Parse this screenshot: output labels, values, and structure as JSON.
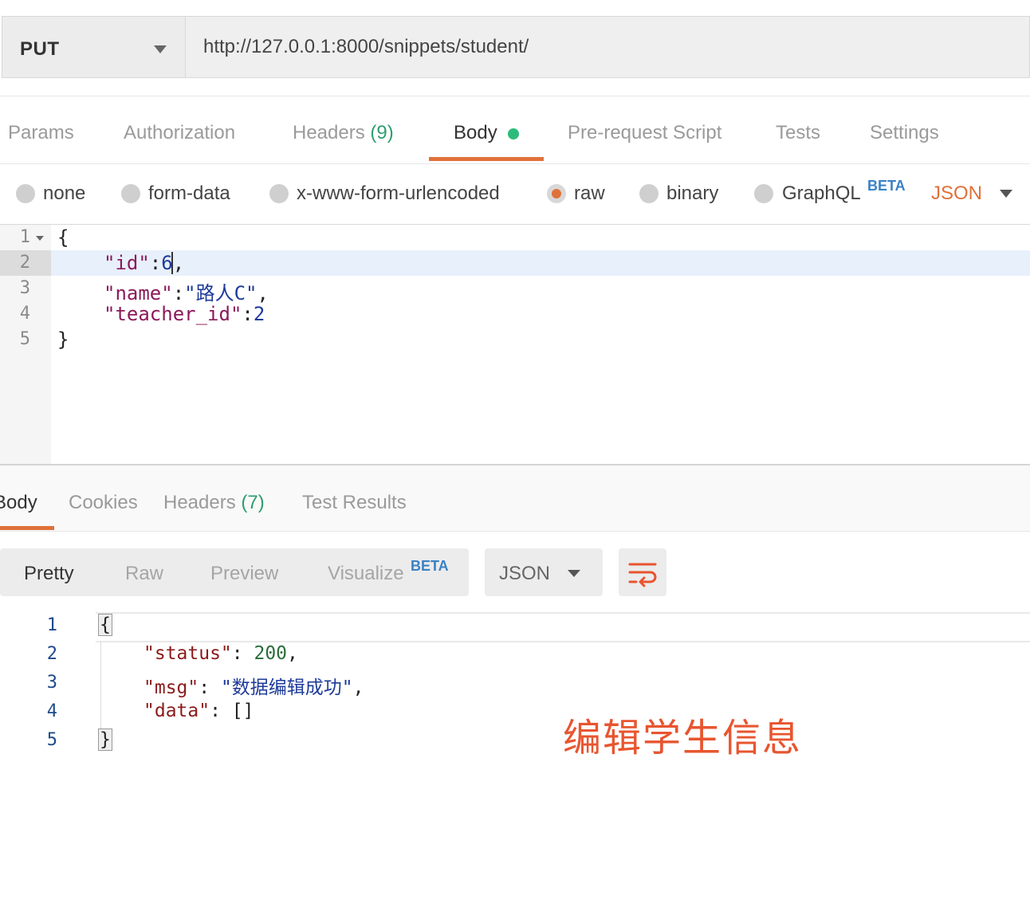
{
  "request": {
    "method": "PUT",
    "url": "http://127.0.0.1:8000/snippets/student/"
  },
  "request_tabs": [
    {
      "label": "Params"
    },
    {
      "label": "Authorization"
    },
    {
      "label": "Headers",
      "count": "(9)"
    },
    {
      "label": "Body",
      "active": true
    },
    {
      "label": "Pre-request Script"
    },
    {
      "label": "Tests"
    },
    {
      "label": "Settings"
    }
  ],
  "body_types": [
    {
      "label": "none"
    },
    {
      "label": "form-data"
    },
    {
      "label": "x-www-form-urlencoded"
    },
    {
      "label": "raw",
      "selected": true
    },
    {
      "label": "binary"
    },
    {
      "label": "GraphQL",
      "badge": "BETA"
    }
  ],
  "body_format": "JSON",
  "request_body": {
    "line_numbers": [
      "1",
      "2",
      "3",
      "4",
      "5"
    ],
    "lines": [
      "{",
      "\"id\":6,",
      "\"name\":\"路人C\",",
      "\"teacher_id\":2",
      "}"
    ],
    "k_id": "\"id\"",
    "v_id": "6",
    "k_name": "\"name\"",
    "v_name": "\"路人C\"",
    "k_teacher": "\"teacher_id\"",
    "v_teacher": "2",
    "open": "{",
    "close": "}",
    "colon": ":",
    "comma": ","
  },
  "response_tabs": [
    {
      "label": "Body",
      "active": true
    },
    {
      "label": "Cookies"
    },
    {
      "label": "Headers",
      "count": "(7)"
    },
    {
      "label": "Test Results"
    }
  ],
  "view_options": [
    {
      "label": "Pretty",
      "active": true
    },
    {
      "label": "Raw"
    },
    {
      "label": "Preview"
    },
    {
      "label": "Visualize",
      "badge": "BETA"
    }
  ],
  "response_format": "JSON",
  "response_body": {
    "line_numbers": [
      "1",
      "2",
      "3",
      "4",
      "5"
    ],
    "k_status": "\"status\"",
    "v_status": "200",
    "k_msg": "\"msg\"",
    "v_msg": "\"数据编辑成功\"",
    "k_data": "\"data\"",
    "v_data": "[]",
    "open": "{",
    "close": "}",
    "colon_sp": ": ",
    "comma": ","
  },
  "annotation": "编辑学生信息",
  "colors": {
    "accent": "#e0713a",
    "active_dot": "#2dbb7b",
    "beta": "#3b82c4",
    "annotation": "#e8552f"
  }
}
